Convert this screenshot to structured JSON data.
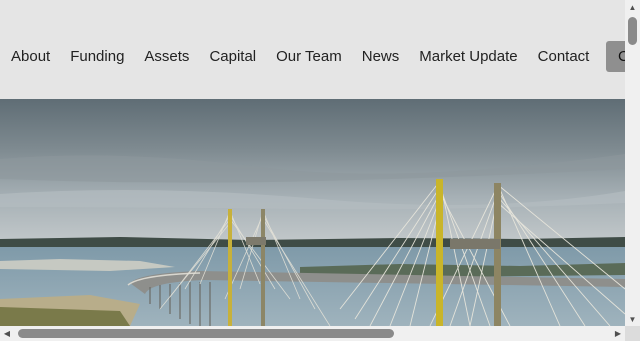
{
  "nav": {
    "items": [
      {
        "label": "About"
      },
      {
        "label": "Funding"
      },
      {
        "label": "Assets"
      },
      {
        "label": "Capital"
      },
      {
        "label": "Our Team"
      },
      {
        "label": "News"
      },
      {
        "label": "Market Update"
      },
      {
        "label": "Contact"
      }
    ],
    "cta_label": "C"
  },
  "hero": {
    "icon": "bridge-photo"
  },
  "scrollbars": {
    "up_icon": "▲",
    "down_icon": "▼",
    "left_icon": "◀",
    "right_icon": "▶"
  },
  "colors": {
    "header_bg": "#e5e5e5",
    "cta_bg": "#8f8f8f",
    "pylon_yellow": "#c9b52a"
  }
}
